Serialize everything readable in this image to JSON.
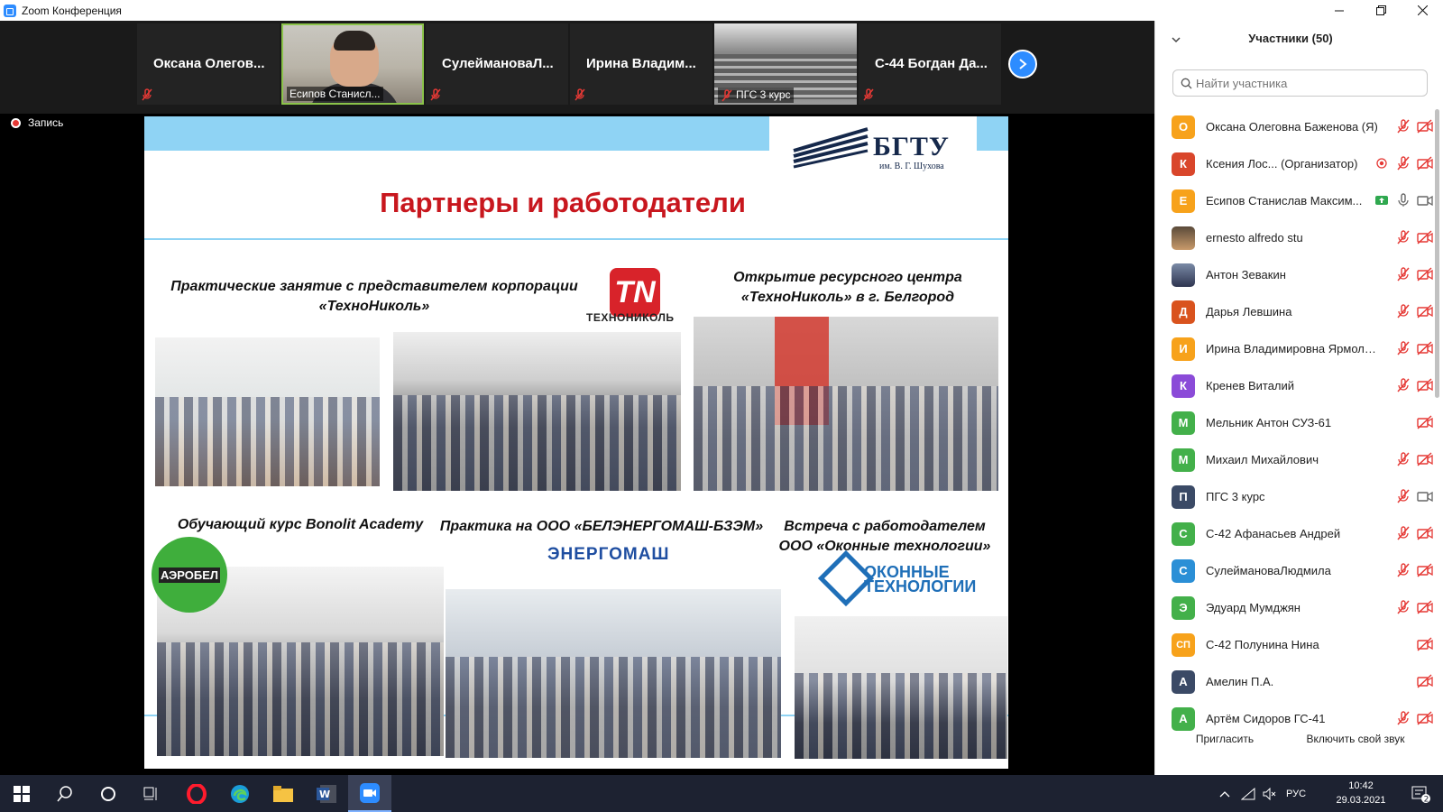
{
  "window": {
    "title": "Zoom Конференция"
  },
  "strip": {
    "tiles": [
      {
        "name": "Оксана Олегов..."
      },
      {
        "caption": "Есипов Станисл..."
      },
      {
        "name": "СулеймановаЛ..."
      },
      {
        "name": "Ирина Владим..."
      },
      {
        "caption": "ПГС 3 курс"
      },
      {
        "name": "С-44 Богдан Да..."
      }
    ]
  },
  "recording": {
    "label": "Запись"
  },
  "slide": {
    "bgtu_name": "БГТУ",
    "bgtu_sub": "им. В. Г. Шухова",
    "title": "Партнеры и работодатели",
    "caption_a": "Практические занятие с представителем корпорации «ТехноНиколь»",
    "caption_b": "Открытие ресурсного центра «ТехноНиколь» в г. Белгород",
    "caption_c": "Обучающий курс Bonolit Academy",
    "caption_d": "Практика на ООО «БЕЛЭНЕРГОМАШ-БЗЭМ»",
    "caption_e": "Встреча с работодателем ООО «Оконные технологии»",
    "tn_logo": "TN",
    "tn_text": "ТЕХНОНИКОЛЬ",
    "aero_logo": "АЭРОБЕЛ",
    "energo_logo": "ЭНЕРГОМАШ",
    "okon_line1": "ОКОННЫЕ",
    "okon_line2": "ТЕХНОЛОГИИ"
  },
  "panel": {
    "title": "Участники (50)",
    "search_placeholder": "Найти участника",
    "participants": [
      {
        "initial": "О",
        "color": "#f7a21b",
        "name": "Оксана Олеговна Баженова (Я)"
      },
      {
        "initial": "К",
        "color": "#d9462b",
        "name": "Ксения Лос... (Организатор)"
      },
      {
        "initial": "Е",
        "color": "#f7a21b",
        "name": "Есипов Станислав Максим..."
      },
      {
        "initial": "",
        "color": "",
        "name": "ernesto alfredo stu"
      },
      {
        "initial": "",
        "color": "",
        "name": "Антон Зевакин"
      },
      {
        "initial": "Д",
        "color": "#d9531e",
        "name": "Дарья Левшина"
      },
      {
        "initial": "И",
        "color": "#f7a21b",
        "name": "Ирина Владимировна Ярмоле..."
      },
      {
        "initial": "К",
        "color": "#8b4bd8",
        "name": "Кренев Виталий"
      },
      {
        "initial": "М",
        "color": "#43b04a",
        "name": "Мельник Антон СУЗ-61"
      },
      {
        "initial": "М",
        "color": "#43b04a",
        "name": "Михаил Михайлович"
      },
      {
        "initial": "П",
        "color": "#3b4a66",
        "name": "ПГС 3 курс"
      },
      {
        "initial": "С",
        "color": "#43b04a",
        "name": "С-42 Афанасьев Андрей"
      },
      {
        "initial": "С",
        "color": "#2b8fd6",
        "name": "СулеймановаЛюдмила"
      },
      {
        "initial": "Э",
        "color": "#43b04a",
        "name": "Эдуард Мумджян"
      },
      {
        "initial": "СП",
        "color": "#f7a21b",
        "name": "С-42 Полунина Нина"
      },
      {
        "initial": "А",
        "color": "#3b4a66",
        "name": "Амелин П.А."
      },
      {
        "initial": "А",
        "color": "#43b04a",
        "name": "Артём Сидоров ГС-41"
      }
    ],
    "invite_label": "Пригласить",
    "unmute_label": "Включить свой звук"
  },
  "taskbar": {
    "language": "РУС",
    "time": "10:42",
    "date": "29.03.2021",
    "notifications": "2"
  },
  "colors": {
    "zoom_blue": "#2d8cff",
    "slide_accent": "#c8171e",
    "slide_band": "#8fd3f4"
  }
}
